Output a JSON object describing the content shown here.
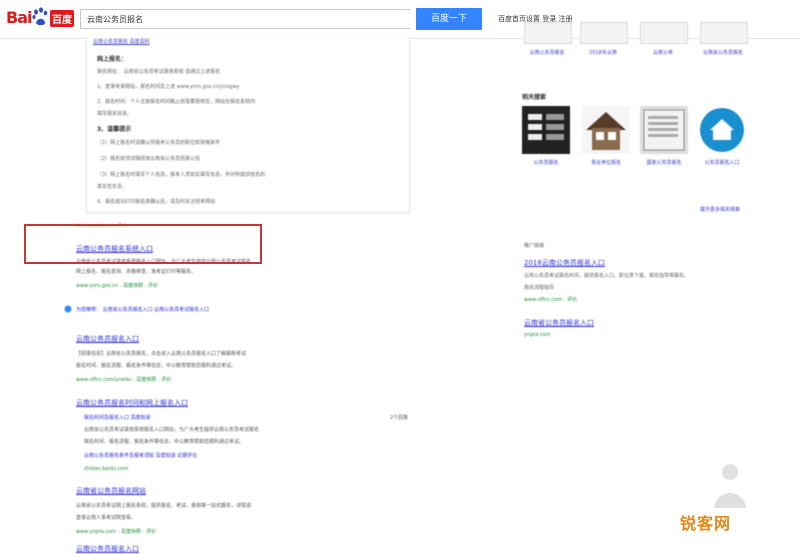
{
  "header": {
    "logo_bai": "Bai",
    "logo_du": "百度",
    "search_value": "云南公务员报名",
    "search_button": "百度一下",
    "links": "百度首页设置  登录  注册"
  },
  "snippet": {
    "lines": [
      "云南公务员报名  百度百科",
      "网上报名：",
      "报名网址：  云南省公务员考试录用系统 请通过上述报名",
      "1、登录考录网站，报名时间及上述  www.ynrs.gov.cn/ynsgwy",
      "2、报名时间：个人注册报名时间截止前需要按规定，网站在报名系统内",
      "填写相关信息。",
      "3、温馨提示",
      "（1）网上报名时请确认所报考公务员的职位和资格条件",
      "（2）报名前须详细阅读云南省公务员招录公告",
      "（3）网上报名时填写个人信息，报考人须如实填写信息，并对所提供信息的",
      "真实性负责。",
      "4、报名成功打印报名表确认后，请及时关注招考网站"
    ],
    "foot": "baike.baidu.com  评价"
  },
  "results": [
    {
      "title": "云南公务员报名系统入口",
      "text": [
        "云南省公务员考试录用系统报名入口网站，为广大考生提供云南公务员考试报名",
        "网上报名、报名查询、资格审查、准考证打印等服务。"
      ],
      "url": "www.ynrs.gov.cn - 百度快照 - 评价"
    },
    {
      "title": "云南公务员报名入口",
      "text": [
        "【招录信息】云南省公务员报名，点击进入云南公务员报名入口了解最新考试",
        "报名时间、报名流程、报名条件等信息，中公教育帮助您顺利通过考试。"
      ],
      "url": "www.offcn.com/ynedu - 百度快照 - 评价"
    },
    {
      "title": "云南公务员报名时间和网上报名入口",
      "sub": [
        "报名时间及报名入口  百度知道",
        "云南公务员报名条件及报考须知 百度知道  近期评论"
      ],
      "url": "zhidao.baidu.com"
    },
    {
      "title": "云南省公务员报名网站",
      "text": [
        "云南省公务员考试网上报名系统，提供报名、考试、录用等一站式服务，详情请",
        "登录云南人事考试网查看。"
      ],
      "url": "www.ynpta.com - 百度快照 - 评价"
    }
  ],
  "extra_search": "为您推荐：  云南省公务员报名入口  云南公务员考试报名入口",
  "right": {
    "top_labels": [
      "云南公务员报名",
      "2018年云南",
      "云南公考",
      "云南省公务员报名"
    ],
    "rel_heading": "相关搜索",
    "rel_labels": [
      "公务员报名",
      "事业单位报名",
      "国家公务员报名",
      "公务员报名入口"
    ],
    "rel_more": "展开更多相关搜索",
    "ad_label": "推广链接",
    "ad_title": "2018云南公务员报名入口",
    "ad_text": [
      "云南公务员考试报名时间，提供报名入口、职位表下载、报名指导等服务。",
      "报名流程指导"
    ],
    "ad_url": "www.offcn.com - 评价",
    "ad2_title": "云南省公务员报名入口",
    "ad2_url": "ynpta.com"
  },
  "watermark": "锐客网"
}
